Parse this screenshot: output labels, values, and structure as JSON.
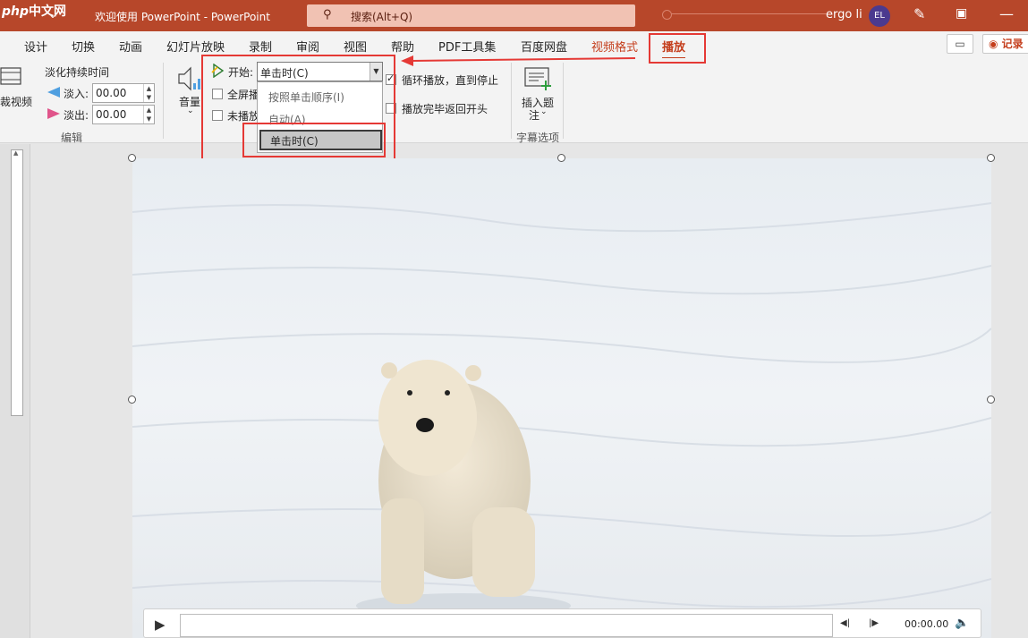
{
  "titlebar": {
    "logo_php": "php",
    "logo_cn": "中文网",
    "doc_title": "欢迎使用 PowerPoint  -  PowerPoint",
    "search": "搜索(Alt+Q)",
    "user": "ergo li",
    "avatar": "EL",
    "bg_color": "#b7472a"
  },
  "tabs": [
    "设计",
    "切换",
    "动画",
    "幻灯片放映",
    "录制",
    "审阅",
    "视图",
    "帮助",
    "PDF工具集",
    "百度网盘",
    "视频格式",
    "播放"
  ],
  "active_tab": "播放",
  "record_label": "记录",
  "ribbon": {
    "trim_label": "裁视频",
    "fade_title": "淡化持续时间",
    "fade_in_label": "淡入:",
    "fade_in_value": "00.00",
    "fade_out_label": "淡出:",
    "fade_out_value": "00.00",
    "edit_group": "编辑",
    "volume_label": "音量",
    "start_label": "开始:",
    "start_value": "单击时(C)",
    "fullscreen_label": "全屏播",
    "hide_label": "未播放",
    "loop_label": "循环播放，直到停止",
    "rewind_label": "播放完毕返回开头",
    "insert_caption_l1": "插入题",
    "insert_caption_l2": "注",
    "caption_group": "字幕选项"
  },
  "dropdown_options": [
    "按照单击顺序(I)",
    "自动(A)",
    "单击时(C)"
  ],
  "selected_option": "单击时(C)",
  "player": {
    "time": "00:00.00"
  },
  "icons": [
    "search-icon",
    "pen-icon",
    "restore-window-icon",
    "minimize-icon",
    "comment-icon",
    "record-icon",
    "volume-icon",
    "play-icon",
    "skip-back-icon",
    "skip-forward-icon",
    "speaker-icon",
    "insert-caption-icon",
    "trim-video-icon",
    "fade-in-icon",
    "fade-out-icon",
    "start-icon"
  ]
}
